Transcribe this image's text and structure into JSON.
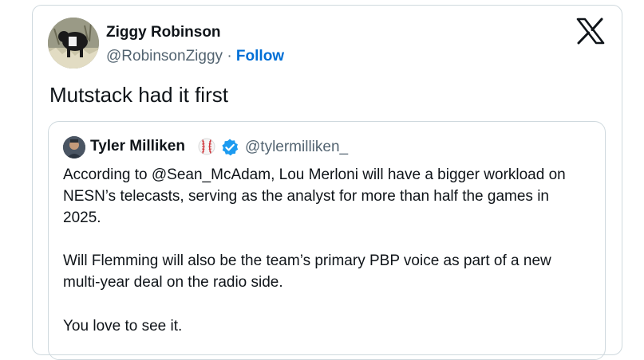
{
  "tweet": {
    "author_name": "Ziggy Robinson",
    "author_handle": "@RobinsonZiggy",
    "separator": "·",
    "follow_label": "Follow",
    "text": "Mutstack had it first"
  },
  "quoted_tweet": {
    "author_name": "Tyler Milliken",
    "author_emoji": "baseball-icon",
    "verified": true,
    "author_handle": "@tylermilliken_",
    "paragraphs": [
      "According to @Sean_McAdam, Lou Merloni will have a bigger workload on NESN’s telecasts, serving as the analyst for more than half the games in 2025.",
      "Will Flemming will also be the team’s primary PBP voice as part of a new multi-year deal on the radio side.",
      "You love to see it."
    ]
  },
  "colors": {
    "text": "#0f1419",
    "secondary": "#536471",
    "follow": "#006fd6",
    "border": "#cfd9de",
    "verified": "#1d9bf0"
  }
}
